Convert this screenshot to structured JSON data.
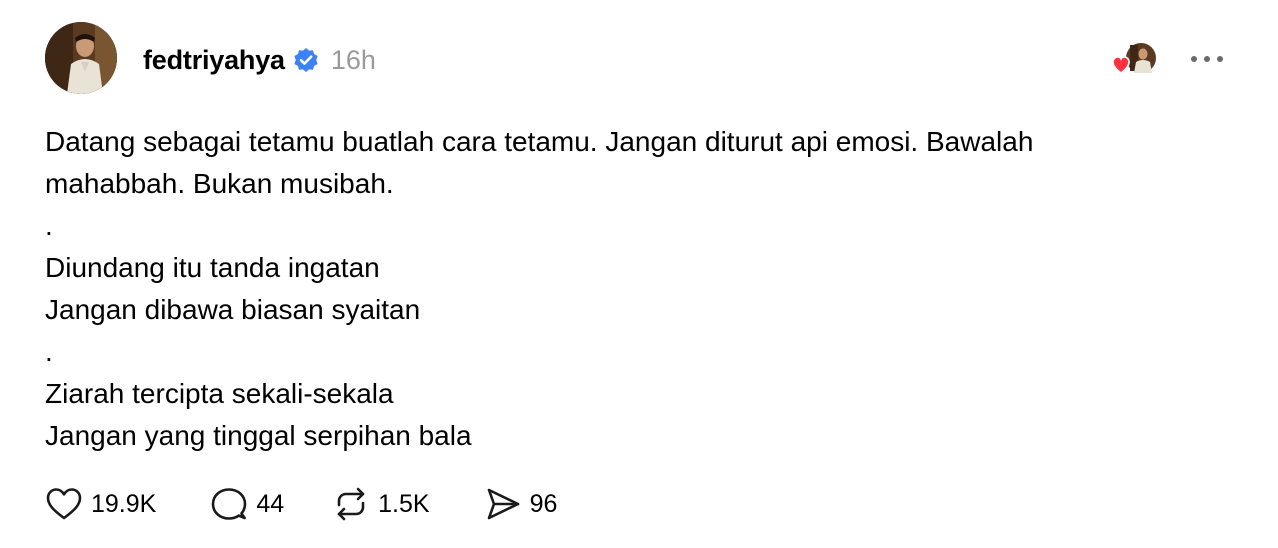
{
  "post": {
    "username": "fedtriyahya",
    "timestamp": "16h",
    "icons": {
      "avatar": "profile-photo",
      "verified": "verified-badge-icon",
      "liked_by": "liked-by-avatar-heart-icon",
      "more": "more-options-icon"
    },
    "body_lines": [
      "Datang sebagai tetamu buatlah cara tetamu. Jangan diturut api emosi. Bawalah",
      "mahabbah. Bukan musibah.",
      ".",
      "Diundang itu tanda ingatan",
      "Jangan dibawa biasan syaitan",
      ".",
      "Ziarah tercipta sekali-sekala",
      "Jangan yang tinggal serpihan bala"
    ],
    "actions": {
      "like": {
        "icon": "heart-icon",
        "count": "19.9K"
      },
      "reply": {
        "icon": "comment-icon",
        "count": "44"
      },
      "repost": {
        "icon": "repost-icon",
        "count": "1.5K"
      },
      "share": {
        "icon": "send-icon",
        "count": "96"
      }
    },
    "colors": {
      "verified": "#3b82f6",
      "timestamp": "#9a9a9a",
      "like_heart": "#ff3040"
    }
  }
}
